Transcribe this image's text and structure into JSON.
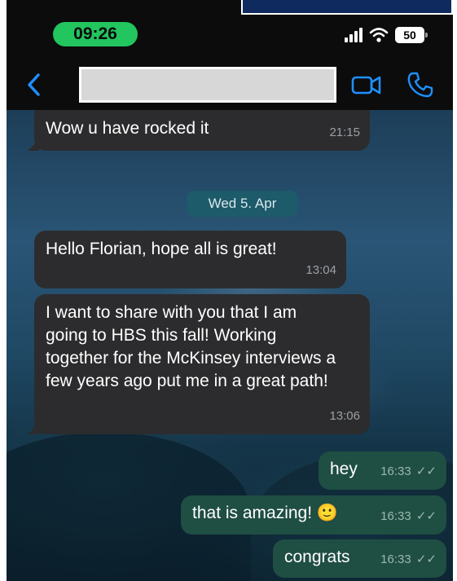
{
  "status_bar": {
    "time": "09:26",
    "battery": "50"
  },
  "header": {
    "back_icon": "chevron-left-icon",
    "video_icon": "video-camera-icon",
    "call_icon": "phone-icon",
    "accent": "#1e90ff"
  },
  "chat": {
    "date_separator": "Wed 5. Apr",
    "messages": [
      {
        "direction": "in",
        "text": "Wow u have rocked it",
        "time": "21:15"
      },
      {
        "direction": "in",
        "text": "Hello Florian, hope all is great!",
        "time": "13:04"
      },
      {
        "direction": "in",
        "text": "I want to share with you that I am going to HBS this fall! Working together for the McKinsey interviews a few years ago put me in a great path!",
        "time": "13:06"
      },
      {
        "direction": "out",
        "text": "hey",
        "time": "16:33"
      },
      {
        "direction": "out",
        "text": "that is amazing! 🙂",
        "time": "16:33"
      },
      {
        "direction": "out",
        "text": "congrats",
        "time": "16:33"
      }
    ],
    "read_receipt": "✓✓"
  },
  "colors": {
    "incoming": "#2c2c2e",
    "outgoing": "#1f4e43",
    "time_pill": "#22c55e"
  }
}
